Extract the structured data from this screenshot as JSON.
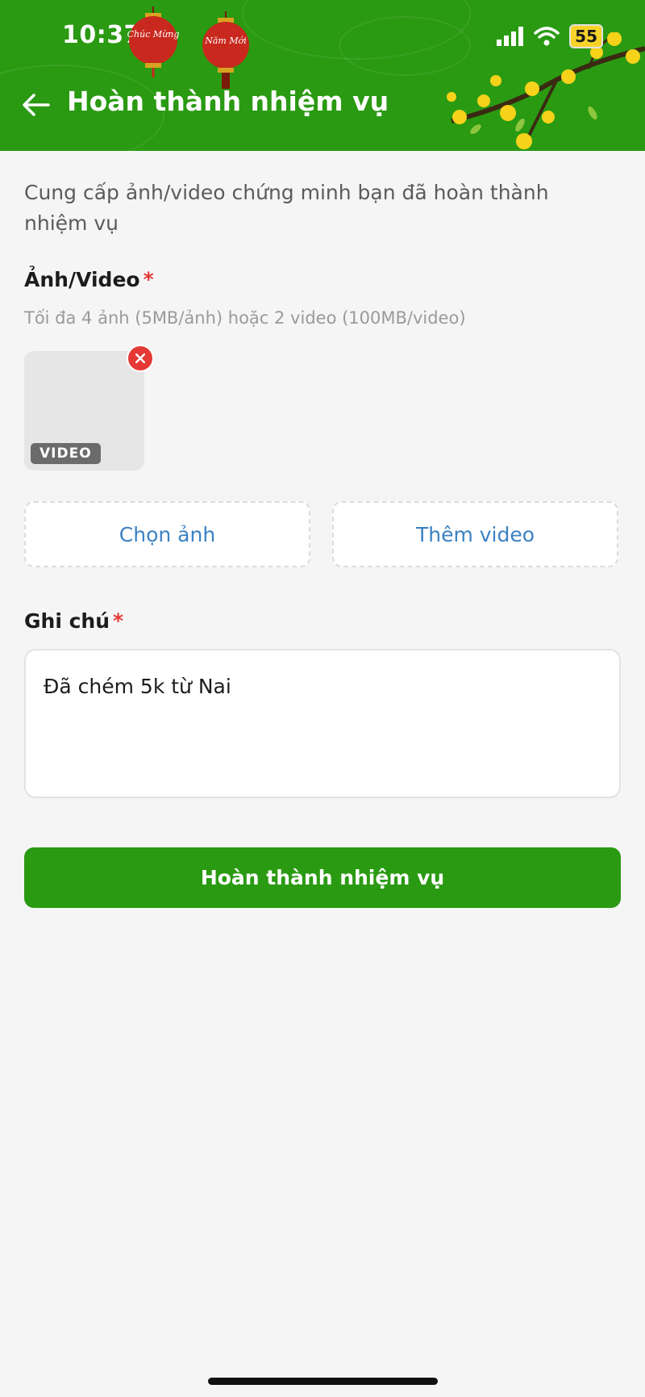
{
  "status_bar": {
    "time": "10:37",
    "battery": "55",
    "lantern_left": "Chúc Mừng",
    "lantern_right": "Năm Mới"
  },
  "header": {
    "title": "Hoàn thành nhiệm vụ",
    "back_icon": "arrow-left-icon"
  },
  "intro": "Cung cấp ảnh/video chứng minh bạn đã hoàn thành nhiệm vụ",
  "media": {
    "label": "Ảnh/Video",
    "required_mark": "*",
    "hint": "Tối đa 4 ảnh (5MB/ảnh) hoặc 2 video (100MB/video)",
    "thumbnail_badge": "VIDEO",
    "choose_photo": "Chọn ảnh",
    "add_video": "Thêm video"
  },
  "note": {
    "label": "Ghi chú",
    "required_mark": "*",
    "value": "Đã chém 5k từ Nai"
  },
  "submit_label": "Hoàn thành nhiệm vụ",
  "colors": {
    "primary_green": "#2a9a12",
    "link_blue": "#3b82c4",
    "required_red": "#e53935"
  }
}
